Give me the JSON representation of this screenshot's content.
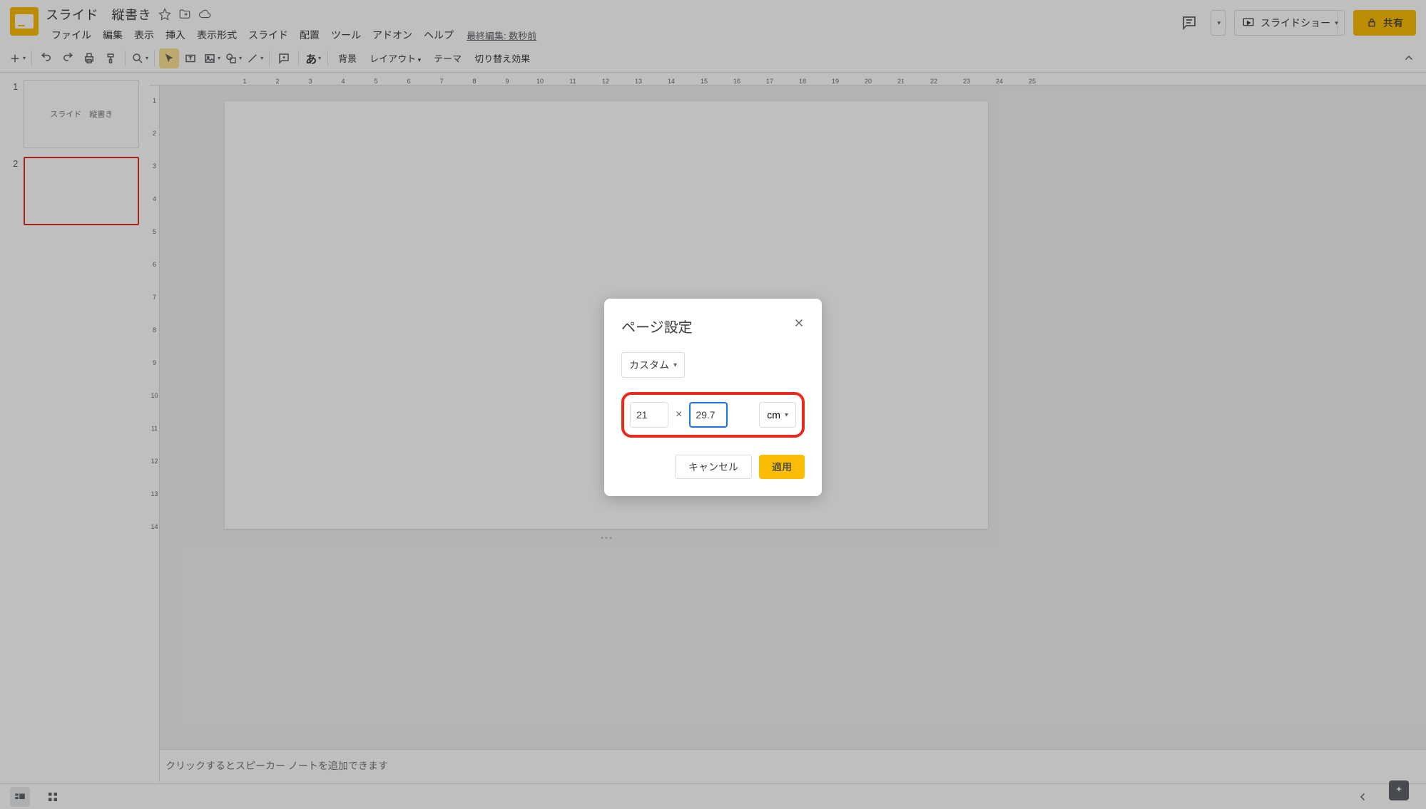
{
  "doc_title": "スライド　縦書き",
  "menus": [
    "ファイル",
    "編集",
    "表示",
    "挿入",
    "表示形式",
    "スライド",
    "配置",
    "ツール",
    "アドオン",
    "ヘルプ"
  ],
  "last_edit": "最終編集: 数秒前",
  "header_buttons": {
    "slideshow": "スライドショー",
    "share": "共有"
  },
  "toolbar_text": {
    "background": "背景",
    "layout": "レイアウト",
    "theme": "テーマ",
    "transition": "切り替え効果"
  },
  "ruler_h": [
    "1",
    "2",
    "3",
    "4",
    "5",
    "6",
    "7",
    "8",
    "9",
    "10",
    "11",
    "12",
    "13",
    "14",
    "15",
    "16",
    "17",
    "18",
    "19",
    "20",
    "21",
    "22",
    "23",
    "24",
    "25"
  ],
  "ruler_v": [
    "1",
    "2",
    "3",
    "4",
    "5",
    "6",
    "7",
    "8",
    "9",
    "10",
    "11",
    "12",
    "13",
    "14"
  ],
  "slides": [
    {
      "num": "1",
      "label": "スライド　縦書き"
    },
    {
      "num": "2",
      "label": ""
    }
  ],
  "notes_placeholder": "クリックするとスピーカー ノートを追加できます",
  "dialog": {
    "title": "ページ設定",
    "preset": "カスタム",
    "width": "21",
    "x": "×",
    "height": "29.7",
    "unit": "cm",
    "cancel": "キャンセル",
    "apply": "適用"
  }
}
